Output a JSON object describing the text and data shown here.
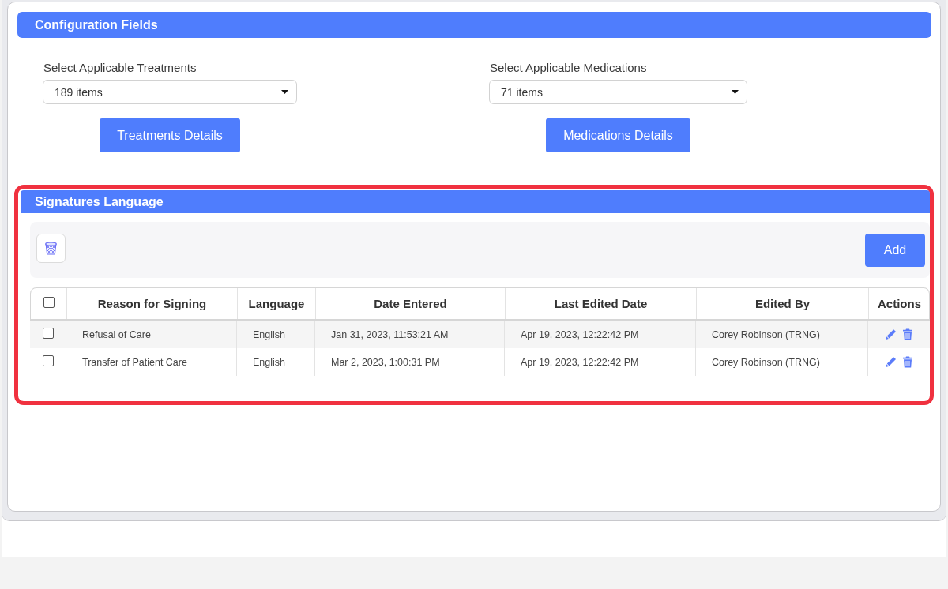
{
  "configuration_fields": {
    "title": "Configuration Fields",
    "selectors": [
      {
        "label": "Select Applicable Treatments",
        "value": "189 items",
        "details_button": "Treatments Details"
      },
      {
        "label": "Select Applicable Medications",
        "value": "71 items",
        "details_button": "Medications Details"
      }
    ]
  },
  "signatures_language": {
    "highlighted": true,
    "title": "Signatures Language",
    "toolbar": {
      "add_button": "Add"
    },
    "table": {
      "select_all_checked": false,
      "columns": [
        "Reason for Signing",
        "Language",
        "Date Entered",
        "Last Edited Date",
        "Edited By",
        "Actions"
      ],
      "rows": [
        {
          "checked": false,
          "cells": [
            "Refusal of Care",
            "English",
            "Jan 31, 2023, 11:53:21 AM",
            "Apr 19, 2023, 12:22:42 PM",
            "Corey Robinson (TRNG)"
          ]
        },
        {
          "checked": false,
          "cells": [
            "Transfer of Patient Care",
            "English",
            "Mar 2, 2023, 1:00:31 PM",
            "Apr 19, 2023, 12:22:42 PM",
            "Corey Robinson (TRNG)"
          ]
        }
      ]
    }
  }
}
